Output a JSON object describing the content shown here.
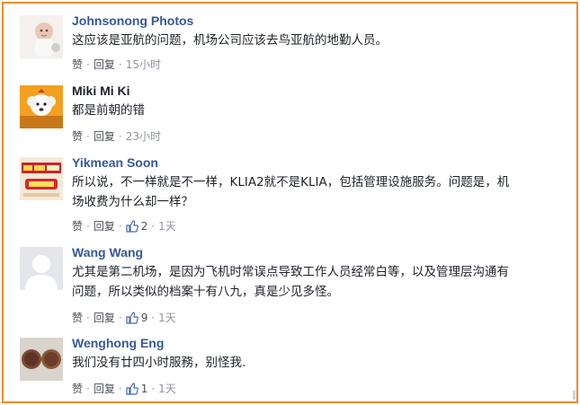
{
  "action_labels": {
    "like": "赞",
    "reply": "回复",
    "separator": "·"
  },
  "colors": {
    "frame": "#f08a2c",
    "author": "#365899",
    "meta": "#90949c"
  },
  "comments": [
    {
      "author": "Johnsonong Photos",
      "text_lines": [
        "这应该是亚航的问题，机场公司应该去鸟亚航的地勤人员。"
      ],
      "time": "15小时",
      "likes": null,
      "avatar_icon": "baby-photo-avatar"
    },
    {
      "author": "Miki Mi Ki",
      "text_lines": [
        "都是前朝的错"
      ],
      "time": "23小时",
      "likes": null,
      "avatar_icon": "dog-photo-avatar"
    },
    {
      "author": "Yikmean Soon",
      "text_lines": [
        "所以说，不一样就是不一样，KLIA2就不是KLIA，包括管理设施服务。问题是，机",
        "场收费为什么却一样？"
      ],
      "time": "1天",
      "likes": "2",
      "avatar_icon": "banner-image-avatar"
    },
    {
      "author": "Wang Wang",
      "text_lines": [
        "尤其是第二机场，是因为飞机时常误点导致工作人员经常白等，以及管理层沟通有",
        "问题，所以类似的档案十有八九，真是少见多怪。"
      ],
      "time": "1天",
      "likes": "9",
      "avatar_icon": "default-silhouette-avatar"
    },
    {
      "author": "Wenghong Eng",
      "text_lines": [
        "我们没有廿四小时服務，别怪我."
      ],
      "time": "1天",
      "likes": "1",
      "avatar_icon": "coins-photo-avatar"
    }
  ]
}
